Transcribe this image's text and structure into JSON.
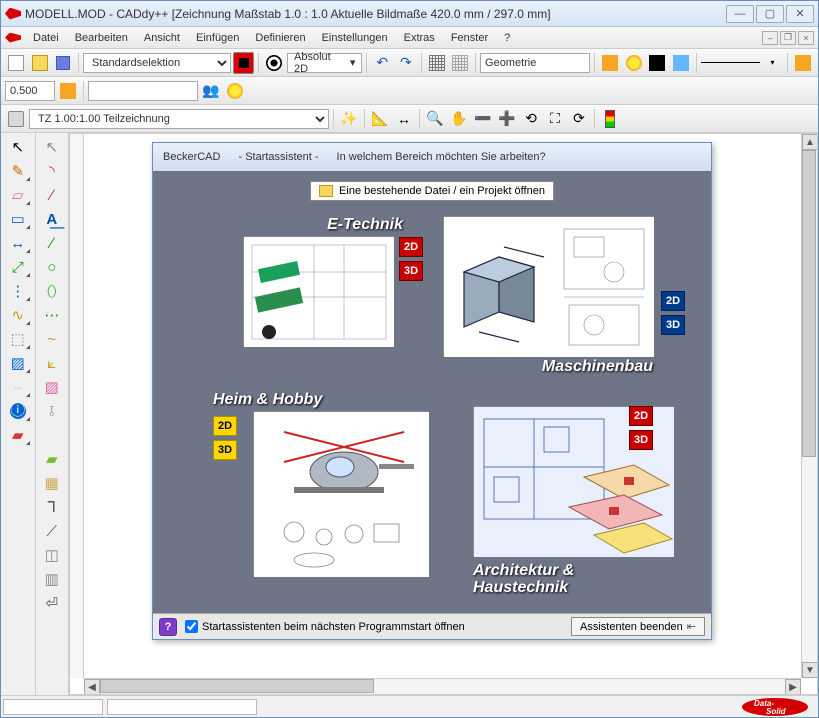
{
  "window": {
    "title": "MODELL.MOD  -  CADdy++ [Zeichnung    Maßstab 1.0 : 1.0   Aktuelle Bildmaße 420.0 mm / 297.0 mm]"
  },
  "menu": [
    "Datei",
    "Bearbeiten",
    "Ansicht",
    "Einfügen",
    "Definieren",
    "Einstellungen",
    "Extras",
    "Fenster",
    "?"
  ],
  "toolbar1": {
    "selection_combo": "Standardselektion",
    "absmode_label": "Absolut 2D",
    "geometry_label": "Geometrie"
  },
  "toolbar2": {
    "numeric": "0.500"
  },
  "toolbar3": {
    "drawing_combo": "TZ 1.00:1.00 Teilzeichnung"
  },
  "wizard": {
    "brand": "BeckerCAD",
    "subtitle": "- Startassistent -",
    "question": "In welchem Bereich möchten Sie arbeiten?",
    "open_existing": "Eine bestehende Datei / ein Projekt öffnen",
    "cat_etechnik": "E-Technik",
    "cat_maschinenbau": "Maschinenbau",
    "cat_heimhobby": "Heim & Hobby",
    "cat_architektur_l1": "Architektur &",
    "cat_architektur_l2": "Haustechnik",
    "btn_2d": "2D",
    "btn_3d": "3D",
    "checkbox_label": "Startassistenten beim nächsten Programmstart öffnen",
    "end_label": "Assistenten beenden"
  },
  "logo": {
    "text1": "Data-",
    "text2": "Solid"
  }
}
